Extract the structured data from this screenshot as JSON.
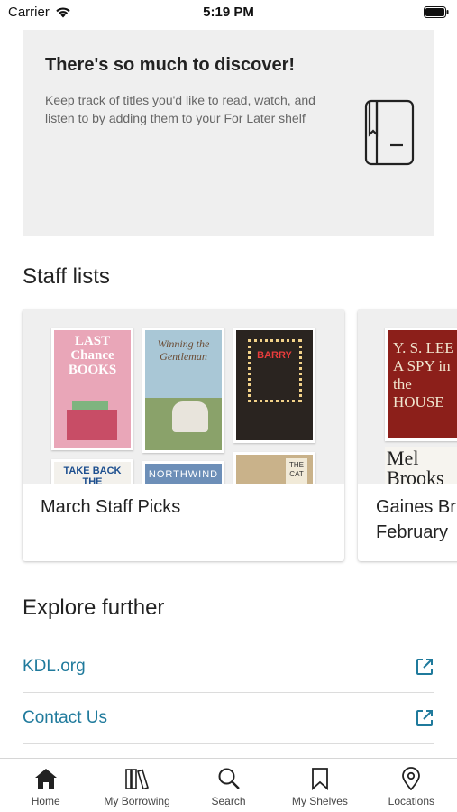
{
  "status_bar": {
    "carrier": "Carrier",
    "time": "5:19 PM"
  },
  "discover": {
    "title": "There's so much to discover!",
    "body": "Keep track of titles you'd like to read, watch, and listen to by adding them to your For Later shelf",
    "icon": "book-bookmark-icon"
  },
  "staff_lists": {
    "heading": "Staff lists",
    "cards": [
      {
        "title": "March Staff Picks",
        "covers": [
          {
            "text": "LAST Chance BOOKS",
            "color": "#e9a6b8"
          },
          {
            "text": "Winning the Gentleman",
            "color": "#a9c7d6"
          },
          {
            "text": "BARRY",
            "color": "#2a2420"
          },
          {
            "text": "TAKE BACK THE",
            "color": "#f3f1ec"
          },
          {
            "text": "NORTHWIND",
            "color": "#6d8fb8"
          },
          {
            "text": "THE CAT",
            "color": "#c9b28a"
          }
        ]
      },
      {
        "title": "Gaines Br",
        "title_line2": "February",
        "covers": [
          {
            "text": "Y. S. LEE  A SPY in the HOUSE",
            "color": "#8c1f1a"
          },
          {
            "text": "Mel Brooks",
            "color": "#f6f4ef"
          }
        ]
      }
    ]
  },
  "explore": {
    "heading": "Explore further",
    "links": [
      {
        "label": "KDL.org",
        "icon": "external-link-icon"
      },
      {
        "label": "Contact Us",
        "icon": "external-link-icon"
      }
    ]
  },
  "tabs": [
    {
      "label": "Home",
      "icon": "home-icon",
      "active": true
    },
    {
      "label": "My Borrowing",
      "icon": "books-icon",
      "active": false
    },
    {
      "label": "Search",
      "icon": "search-icon",
      "active": false
    },
    {
      "label": "My Shelves",
      "icon": "bookmark-icon",
      "active": false
    },
    {
      "label": "Locations",
      "icon": "location-pin-icon",
      "active": false
    }
  ],
  "colors": {
    "link": "#1f7a9c",
    "card_bg": "#efefef",
    "text": "#222222"
  }
}
